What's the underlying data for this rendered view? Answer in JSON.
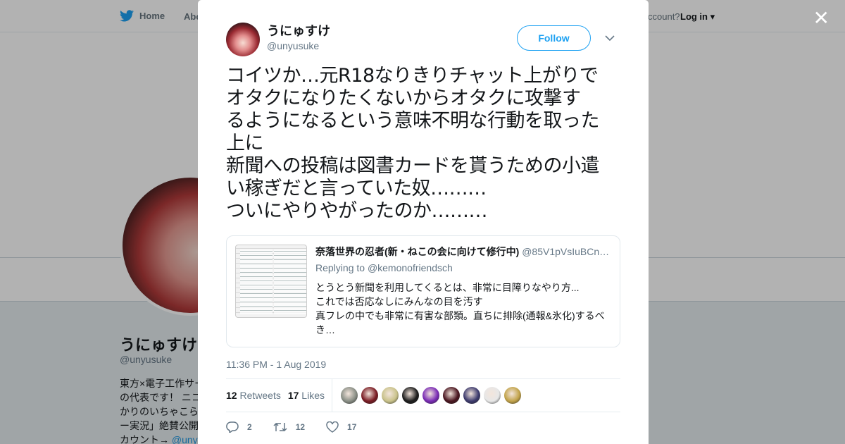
{
  "background": {
    "nav_home": "Home",
    "nav_about": "Abo",
    "nav_account": "ccount?",
    "nav_login": "Log in",
    "profile_name": "うにゅすけ",
    "profile_handle": "@unyusuke",
    "bio_lines": [
      "東方×電子工作サー",
      "の代表です！ ニコ",
      "かりのいちゃこら",
      "ー実況」絶賛公開",
      "カウント→ "
    ],
    "bio_link": "@uny"
  },
  "tweet": {
    "display_name": "うにゅすけ",
    "screen_name": "@unyusuke",
    "follow_label": "Follow",
    "text": "コイツか…元R18なりきりチャット上がりで\nオタクになりたくないからオタクに攻撃す\nるようになるという意味不明な行動を取った\n上に\n新聞への投稿は図書カードを貰うための小遣\nい稼ぎだと言っていた奴………\nついにやりやがったのか………",
    "quote": {
      "name": "奈落世界の忍者(新・ねこの会に向けて修行中)",
      "handle": "@85V1pVsIuBCn…",
      "replying_to_prefix": "Replying to ",
      "replying_to": "@kemonofriendsch",
      "text": "とうとう新聞を利用してくるとは、非常に目障りなやり方...\nこれでは否応なしにみんなの目を汚す\n真フレの中でも非常に有害な部類。直ちに排除(通報&氷化)するべき…"
    },
    "timestamp": "11:36 PM - 1 Aug 2019",
    "retweets_count": "12",
    "retweets_label": "Retweets",
    "likes_count": "17",
    "likes_label": "Likes",
    "liker_colors": [
      "#8a8f86",
      "#7a1c24",
      "#c9c28a",
      "#1d1d1d",
      "#7a2bb5",
      "#4a1620",
      "#3d3b6e",
      "#e7e7e7",
      "#c2a34a"
    ],
    "actions": {
      "reply_count": "2",
      "retweet_count": "12",
      "like_count": "17"
    }
  },
  "colors": {
    "accent": "#1da1f2",
    "muted": "#657786"
  }
}
